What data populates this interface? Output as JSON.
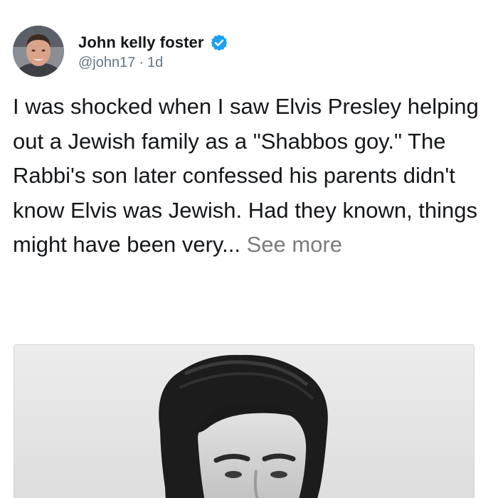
{
  "post": {
    "author_name": "John kelly foster",
    "handle": "@john17",
    "separator": "·",
    "time_ago": "1d",
    "body_text": "I was shocked when I saw Elvis Presley helping out a Jewish family as a \"Shabbos goy.\" The Rabbi's son later confessed his parents didn't know Elvis was Jewish. Had they known, things might have been very...",
    "see_more_label": "See more"
  },
  "icons": {
    "verified": "verified-badge-icon",
    "avatar": "profile-photo"
  },
  "colors": {
    "text": "#14171a",
    "secondary_text": "#657786",
    "see_more": "#7c7c7c",
    "verified_badge": "#1da1f2",
    "background": "#ffffff"
  }
}
